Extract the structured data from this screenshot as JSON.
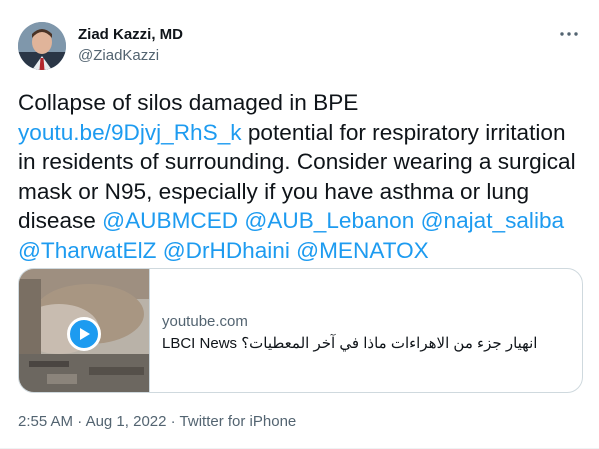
{
  "author": {
    "name": "Ziad Kazzi, MD",
    "handle": "@ZiadKazzi"
  },
  "more_icon": "more-horizontal-icon",
  "tweet": {
    "text_1": "Collapse of silos damaged in BPE",
    "link_1": "youtu.be/9Djvj_RhS_k",
    "text_2": "potential for respiratory irritation in residents of surrounding. Consider wearing a surgical mask or N95, especially if you have asthma or lung disease",
    "mentions": [
      "@AUBMCED",
      "@AUB_Lebanon",
      "@najat_saliba",
      "@TharwatElZ",
      "@DrHDhaini",
      "@MENATOX"
    ]
  },
  "card": {
    "domain": "youtube.com",
    "title": "LBCI News انهيار جزء من الاهراءات ماذا في آخر المعطيات؟",
    "play_icon": "play-icon"
  },
  "meta": {
    "time": "2:55 AM",
    "date": "Aug 1, 2022",
    "source": "Twitter for iPhone",
    "separator": "·"
  },
  "colors": {
    "link": "#1d9bf0",
    "text": "#0f1419",
    "secondary": "#536471",
    "border": "#cfd9de"
  }
}
